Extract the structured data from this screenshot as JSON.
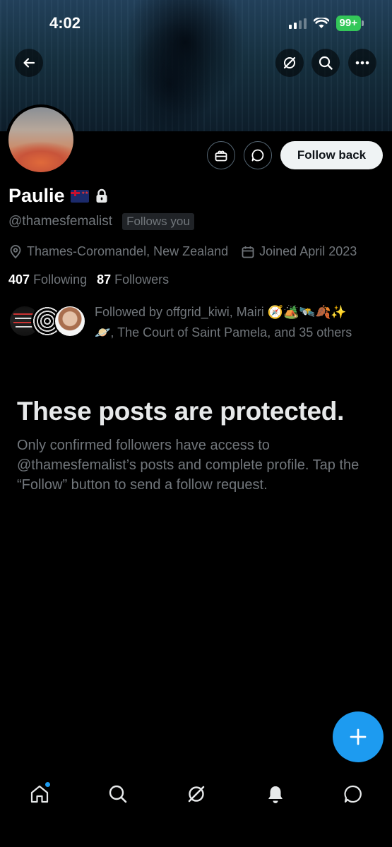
{
  "status_bar": {
    "time": "4:02",
    "battery": "99+"
  },
  "header": {
    "icons": [
      "back-arrow-icon",
      "grok-icon",
      "search-icon",
      "more-icon"
    ]
  },
  "profile": {
    "actions": {
      "follow_back_label": "Follow back"
    },
    "name": "Paulie",
    "handle": "@thamesfemalist",
    "follows_you_badge": "Follows you",
    "location": "Thames-Coromandel, New Zealand",
    "joined": "Joined April 2023",
    "following_count": "407",
    "following_label": "Following",
    "followers_count": "87",
    "followers_label": "Followers",
    "followed_by_line1": "Followed by offgrid_kiwi, Mairi 🧭🏕️🛰️🍂✨",
    "followed_by_line2": "🪐, The Court of Saint Pamela, and 35 others"
  },
  "protected": {
    "title": "These posts are protected.",
    "body": "Only confirmed followers have access to @thamesfemalist’s posts and complete profile. Tap the “Follow” button to send a follow request."
  },
  "colors": {
    "accent": "#1d9bf0",
    "background": "#000000",
    "secondary_text": "#71767b",
    "battery": "#34c759"
  },
  "tab_bar": {
    "tabs": [
      "home-icon",
      "search-icon",
      "grok-icon",
      "notifications-icon",
      "messages-icon"
    ]
  }
}
